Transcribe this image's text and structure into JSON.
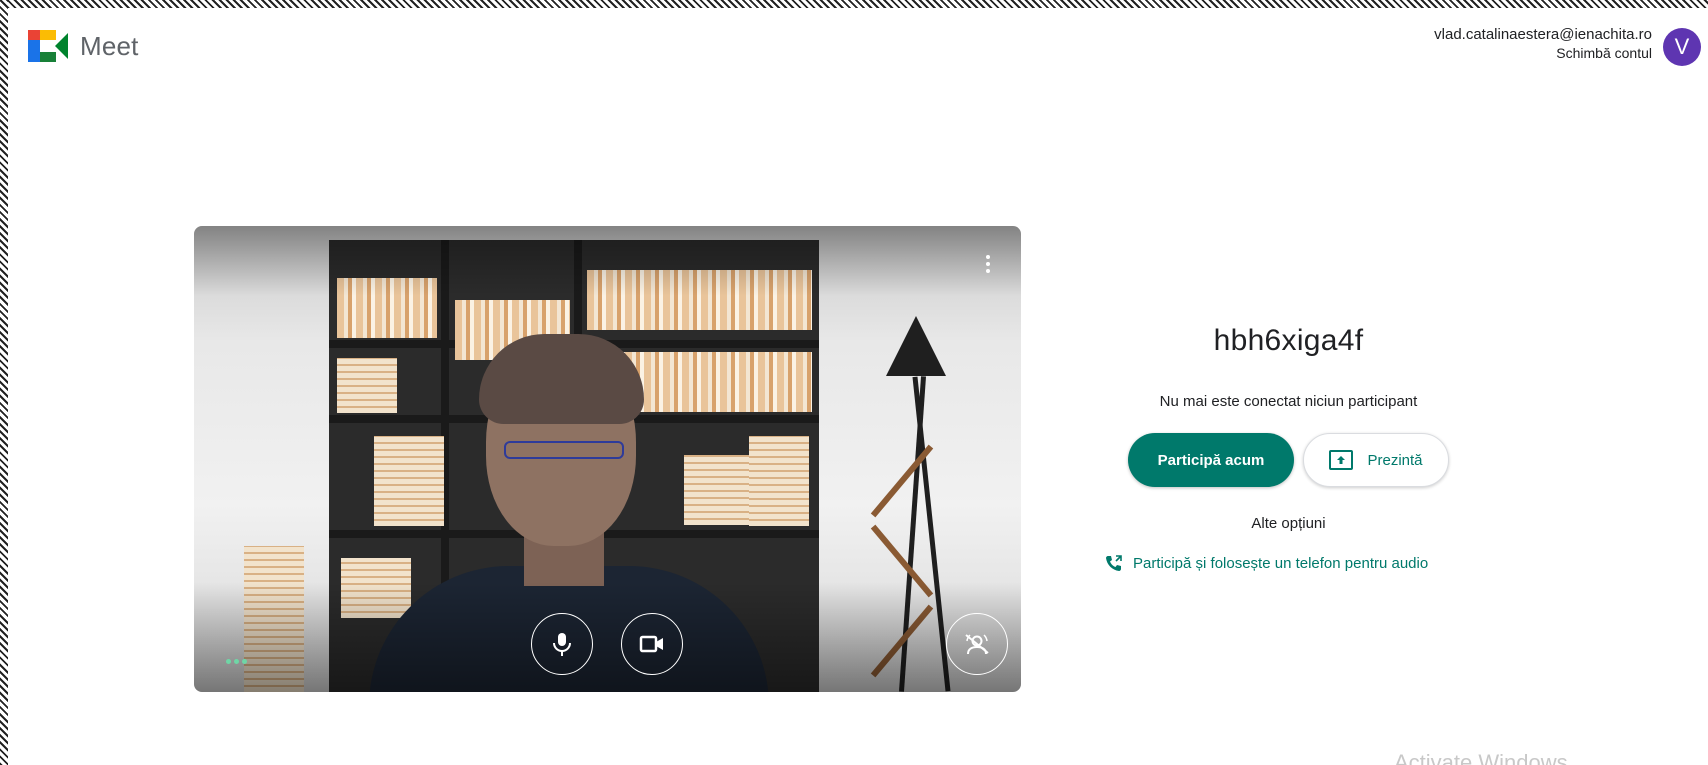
{
  "header": {
    "app_name": "Meet",
    "account_email": "vlad.catalinaestera@ienachita.ro",
    "switch_account_label": "Schimbă contul",
    "avatar_letter": "V"
  },
  "preview": {
    "icons": {
      "more": "more-vert-icon",
      "mic": "microphone-icon",
      "camera": "videocam-icon",
      "effects": "visual-effects-icon"
    }
  },
  "panel": {
    "meeting_code": "hbh6xiga4f",
    "status_text": "Nu mai este conectat niciun participant",
    "join_label": "Participă acum",
    "present_label": "Prezintă",
    "other_options_label": "Alte opțiuni",
    "phone_audio_label": "Participă și folosește un telefon pentru audio"
  },
  "watermark": "Activate Windows",
  "colors": {
    "accent": "#00796b",
    "avatar": "#5e35b1"
  }
}
